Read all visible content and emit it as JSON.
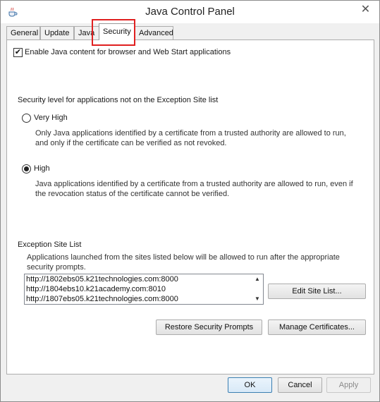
{
  "window": {
    "title": "Java Control Panel",
    "close_glyph": "✕"
  },
  "tabs": [
    {
      "label": "General"
    },
    {
      "label": "Update"
    },
    {
      "label": "Java"
    },
    {
      "label": "Security",
      "active": true
    },
    {
      "label": "Advanced"
    }
  ],
  "security": {
    "enable_label": "Enable Java content for browser and Web Start applications",
    "enable_checked": true,
    "level_heading": "Security level for applications not on the Exception Site list",
    "very_high": {
      "label": "Very High",
      "description": "Only Java applications identified by a certificate from a trusted authority are allowed to run, and only if the certificate can be verified as not revoked."
    },
    "high": {
      "label": "High",
      "description": "Java applications identified by a certificate from a trusted authority are allowed to run, even if the revocation status of the certificate cannot be verified."
    },
    "selected_level": "High",
    "exception_heading": "Exception Site List",
    "exception_description": "Applications launched from the sites listed below will be allowed to run after the appropriate security prompts.",
    "sites": [
      "http://1802ebs05.k21technologies.com:8000",
      "http://1804ebs10.k21academy.com:8010",
      "http://1807ebs05.k21technologies.com:8000"
    ],
    "edit_site_list_label": "Edit Site List...",
    "restore_prompts_label": "Restore Security Prompts",
    "manage_certificates_label": "Manage Certificates..."
  },
  "footer": {
    "ok_label": "OK",
    "cancel_label": "Cancel",
    "apply_label": "Apply"
  },
  "colors": {
    "highlight": "#e02020",
    "default_button_border": "#3c7fb1"
  }
}
